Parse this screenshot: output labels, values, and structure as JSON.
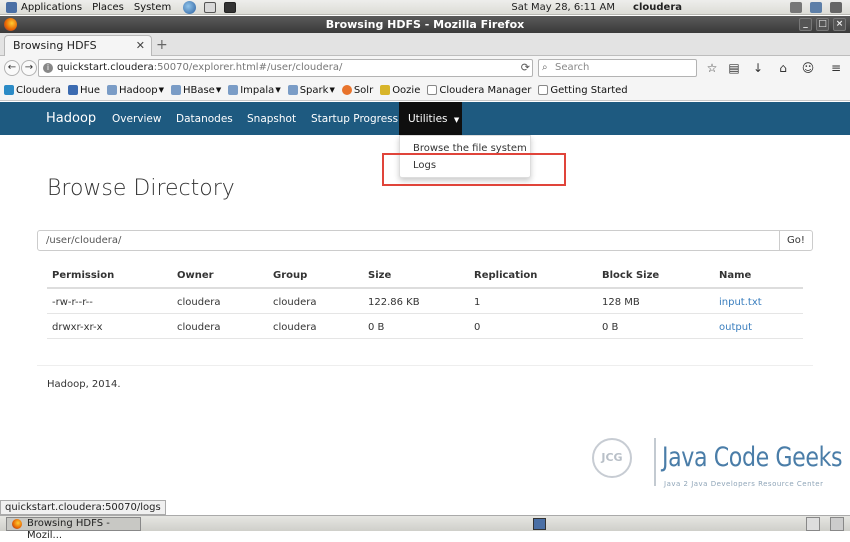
{
  "gnome_panel": {
    "applications": "Applications",
    "places": "Places",
    "system": "System",
    "datetime": "Sat May 28,  6:11 AM",
    "user": "cloudera"
  },
  "window": {
    "title": "Browsing HDFS - Mozilla Firefox"
  },
  "tab": {
    "label": "Browsing HDFS"
  },
  "urlbar": {
    "host": "quickstart.cloudera",
    "rest": ":50070/explorer.html#/user/cloudera/"
  },
  "search": {
    "placeholder": "Search"
  },
  "bookmarks": [
    {
      "label": "Cloudera"
    },
    {
      "label": "Hue"
    },
    {
      "label": "Hadoop"
    },
    {
      "label": "HBase"
    },
    {
      "label": "Impala"
    },
    {
      "label": "Spark"
    },
    {
      "label": "Solr"
    },
    {
      "label": "Oozie"
    },
    {
      "label": "Cloudera Manager"
    },
    {
      "label": "Getting Started"
    }
  ],
  "hadoop_nav": {
    "brand": "Hadoop",
    "items": [
      "Overview",
      "Datanodes",
      "Snapshot",
      "Startup Progress"
    ],
    "utilities": "Utilities"
  },
  "dropdown": {
    "items": [
      "Browse the file system",
      "Logs"
    ]
  },
  "page": {
    "title": "Browse Directory",
    "path": "/user/cloudera/",
    "go": "Go!"
  },
  "table": {
    "headers": [
      "Permission",
      "Owner",
      "Group",
      "Size",
      "Replication",
      "Block Size",
      "Name"
    ],
    "rows": [
      [
        "-rw-r--r--",
        "cloudera",
        "cloudera",
        "122.86 KB",
        "1",
        "128 MB",
        "input.txt"
      ],
      [
        "drwxr-xr-x",
        "cloudera",
        "cloudera",
        "0 B",
        "0",
        "0 B",
        "output"
      ]
    ]
  },
  "footer": "Hadoop, 2014.",
  "watermark": {
    "title": "Java Code Geeks",
    "subtitle": "Java 2 Java Developers Resource Center",
    "logo": "JCG"
  },
  "status_tip": "quickstart.cloudera:50070/logs",
  "taskbar": {
    "item": "Browsing HDFS - Mozil..."
  },
  "colors": {
    "hadoop_nav": "#1e5a80",
    "link": "#3a7ebe",
    "highlight": "#e0443a"
  }
}
